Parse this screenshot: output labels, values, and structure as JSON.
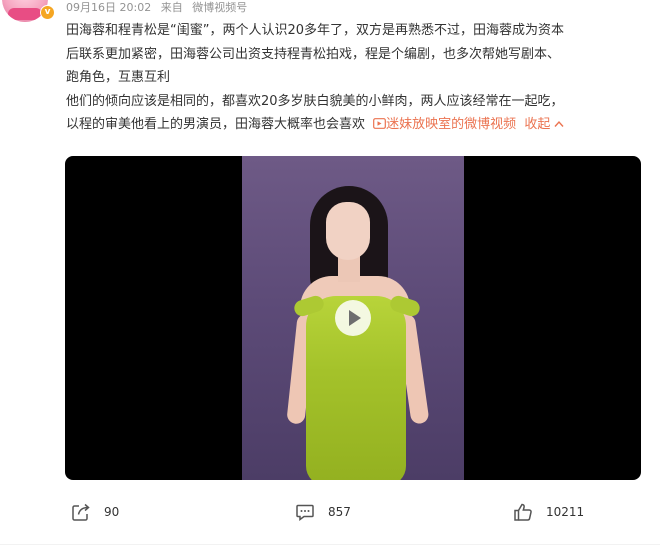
{
  "post": {
    "meta": {
      "date": "09月16日 20:02",
      "from_label": "来自",
      "source": "微博视频号"
    },
    "text_lines": [
      "田海蓉和程青松是“闺蜜”，两个人认识20多年了，双方是再熟悉不过，田海蓉成为资本",
      "后联系更加紧密，田海蓉公司出资支持程青松拍戏，程是个编剧，也多次帮她写剧本、",
      "跑角色，互惠互利",
      "他们的倾向应该是相同的，都喜欢20多岁肤白貌美的小鲜肉，两人应该经常在一起吃，",
      "以程的审美他看上的男演员，田海蓉大概率也会喜欢"
    ],
    "video_link_label": "迷妹放映室的微博视频",
    "collapse_label": "收起"
  },
  "actions": {
    "share_count": "90",
    "comment_count": "857",
    "like_count": "10211"
  },
  "icons": {
    "verified": "verified-badge-icon",
    "video_link": "video-link-icon",
    "collapse": "chevron-up-icon",
    "play": "play-icon",
    "share": "share-icon",
    "comment": "comment-icon",
    "like": "thumbs-up-icon"
  },
  "colors": {
    "link": "#eb7350",
    "meta": "#939393",
    "badge": "#f5a623",
    "dress": "#a4c22a"
  }
}
